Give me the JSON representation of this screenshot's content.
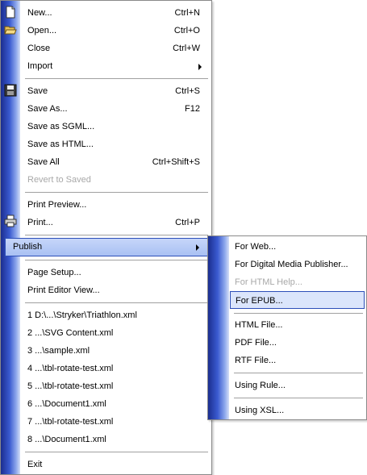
{
  "main_menu": {
    "new": {
      "label": "New...",
      "shortcut": "Ctrl+N"
    },
    "open": {
      "label": "Open...",
      "shortcut": "Ctrl+O"
    },
    "close": {
      "label": "Close",
      "shortcut": "Ctrl+W"
    },
    "import": {
      "label": "Import"
    },
    "save": {
      "label": "Save",
      "shortcut": "Ctrl+S"
    },
    "save_as": {
      "label": "Save As...",
      "shortcut": "F12"
    },
    "save_as_sgml": {
      "label": "Save as SGML..."
    },
    "save_as_html": {
      "label": "Save as HTML..."
    },
    "save_all": {
      "label": "Save All",
      "shortcut": "Ctrl+Shift+S"
    },
    "revert_to_saved": {
      "label": "Revert to Saved"
    },
    "print_preview": {
      "label": "Print Preview..."
    },
    "print": {
      "label": "Print...",
      "shortcut": "Ctrl+P"
    },
    "publish": {
      "label": "Publish"
    },
    "page_setup": {
      "label": "Page Setup..."
    },
    "print_editor_view": {
      "label": "Print Editor View..."
    },
    "recent_files": [
      "1 D:\\...\\Stryker\\Triathlon.xml",
      "2 ...\\SVG Content.xml",
      "3 ...\\sample.xml",
      "4 ...\\tbl-rotate-test.xml",
      "5 ...\\tbl-rotate-test.xml",
      "6 ...\\Document1.xml",
      "7 ...\\tbl-rotate-test.xml",
      "8 ...\\Document1.xml"
    ],
    "exit": {
      "label": "Exit"
    }
  },
  "publish_submenu": {
    "for_web": "For Web...",
    "for_digital_media_publisher": "For Digital Media Publisher...",
    "for_html_help": "For HTML Help...",
    "for_epub": "For EPUB...",
    "html_file": "HTML File...",
    "pdf_file": "PDF File...",
    "rtf_file": "RTF File...",
    "using_rule": "Using Rule...",
    "using_xsl": "Using XSL..."
  },
  "colors": {
    "strip_dark": "#1b2e8f",
    "highlight_border": "#2d4fb8",
    "highlight_fill": "#b4c8f5",
    "disabled_text": "#a8a8a8"
  },
  "icons": {
    "new": "new-document-icon",
    "open": "open-folder-icon",
    "save": "floppy-disk-icon",
    "print": "printer-icon"
  }
}
